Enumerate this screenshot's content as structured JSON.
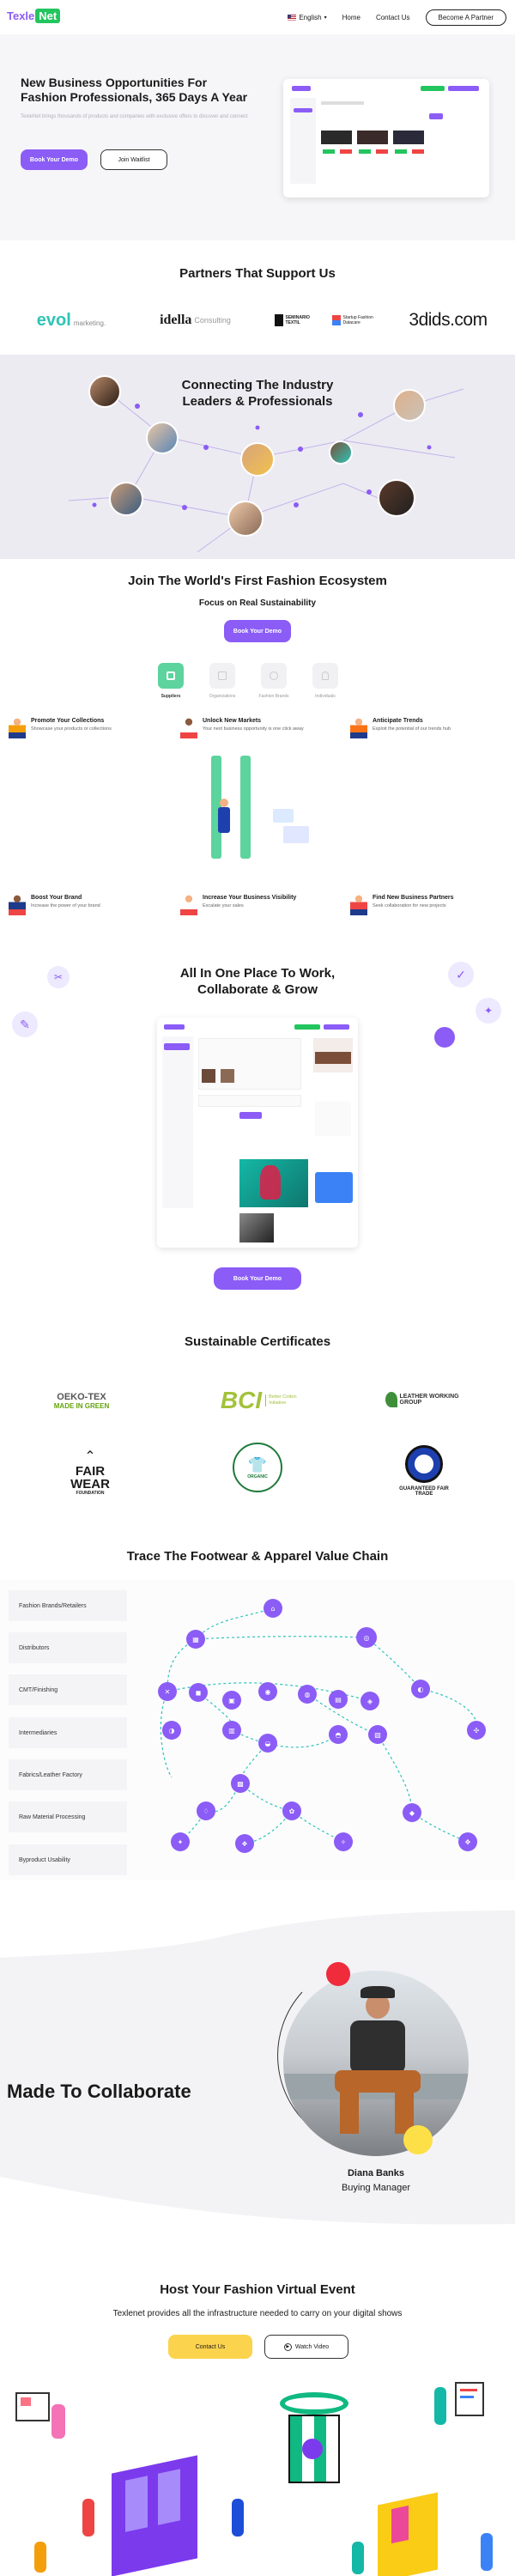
{
  "header": {
    "logo_part1": "Texle",
    "logo_part2": "Net",
    "language": "English",
    "nav": [
      "Home",
      "Contact Us"
    ],
    "cta": "Become A Partner"
  },
  "hero": {
    "title": "New Business Opportunities For Fashion Professionals, 365 Days A Year",
    "subtitle": "TexleNet brings thousands of products and companies with exclusive offers to discover and connect",
    "primary_button": "Book Your Demo",
    "secondary_button": "Join Waitlist"
  },
  "partners": {
    "title": "Partners That Support Us",
    "logos": [
      "evol",
      "marketing.",
      "idella",
      "Consulting",
      "SEMINARIO TEXTIL",
      "Startup Fashion Datacare",
      "3dids.com"
    ]
  },
  "network": {
    "title_line1": "Connecting The Industry",
    "title_line2": "Leaders & Professionals"
  },
  "ecosystem": {
    "title": "Join The World's First Fashion Ecosystem",
    "subtitle": "Focus on Real Sustainability",
    "button": "Book Your Demo",
    "tabs": [
      "Suppliers",
      "Organizations",
      "Fashion Brands",
      "Individuals"
    ],
    "features": [
      {
        "title": "Promote Your Collections",
        "desc": "Showcase your products or collections"
      },
      {
        "title": "Unlock New Markets",
        "desc": "Your next business opportunity is one click away"
      },
      {
        "title": "Anticipate Trends",
        "desc": "Exploit the potential of our trends hub"
      },
      {
        "title": "Boost Your Brand",
        "desc": "Increase the power of your brand"
      },
      {
        "title": "Increase Your Business Visibility",
        "desc": "Escalate your sales"
      },
      {
        "title": "Find New Business Partners",
        "desc": "Seek collaboration for new projects"
      }
    ]
  },
  "work": {
    "title_line1": "All In One Place To Work,",
    "title_line2": "Collaborate & Grow",
    "button": "Book Your Demo"
  },
  "certificates": {
    "title": "Sustainable Certificates",
    "items": [
      "OEKO-TEX",
      "MADE IN GREEN",
      "BCI",
      "Better Cotton Initiative",
      "LEATHER WORKING GROUP",
      "FAIR",
      "WEAR",
      "FOUNDATION",
      "ORGANIC",
      "GUARANTEED FAIR TRADE"
    ]
  },
  "value_chain": {
    "title": "Trace The Footwear & Apparel Value Chain",
    "rows": [
      "Fashion Brands/Retailers",
      "Distributors",
      "CMT/Finishing",
      "Intermediaries",
      "Fabrics/Leather Factory",
      "Raw Material Processing",
      "Byproduct Usability"
    ]
  },
  "collaborate": {
    "title": "Made To Collaborate",
    "person_name": "Diana Banks",
    "person_role": "Buying Manager"
  },
  "event": {
    "title": "Host Your Fashion Virtual Event",
    "subtitle": "Texlenet provides all the infrastructure needed to carry on your digital shows",
    "primary_button": "Contact Us",
    "secondary_button": "Watch Video"
  },
  "colors": {
    "accent": "#8b5cf6",
    "green": "#22c55e",
    "yellow": "#fcd34d",
    "teal": "#2ec4b6"
  }
}
